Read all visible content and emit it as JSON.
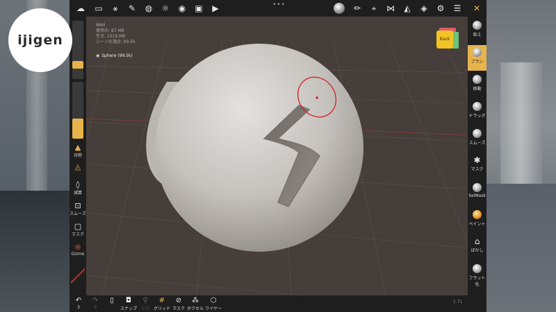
{
  "watermark": {
    "text": "ijigen"
  },
  "topbar": {
    "handle": "•••",
    "left_icons": [
      "cloud-icon",
      "folder-icon",
      "scene-icon",
      "tools-icon",
      "globe-icon",
      "sun-icon",
      "material-icon",
      "image-icon",
      "video-icon"
    ],
    "right_icons": [
      "matcap-icon",
      "paint-icon",
      "picker-icon",
      "symmetry-icon",
      "shading-icon",
      "layers-icon",
      "settings-icon",
      "sliders-icon",
      "wrench-icon"
    ]
  },
  "info": {
    "lines": [
      "RAM",
      "使用中: 87 MB",
      "空き: 1519 MB",
      "シーンの頂点: 99.5k"
    ],
    "mesh_label": "Sphere (99.5k)"
  },
  "left_panel": {
    "radius_fill": 0.25,
    "intensity_fill": 0.35,
    "items": [
      {
        "label": "対称"
      },
      {
        "label": "減算"
      },
      {
        "label": "スムーズ"
      },
      {
        "label": "マスク"
      },
      {
        "label": "Gizmo"
      }
    ]
  },
  "right_panel": {
    "items": [
      {
        "label": "粘土",
        "active": false
      },
      {
        "label": "ブラシ",
        "active": true
      },
      {
        "label": "移動",
        "active": false
      },
      {
        "label": "ドラッグ",
        "active": false
      },
      {
        "label": "スムーズ",
        "active": false
      },
      {
        "label": "マスク",
        "active": false
      },
      {
        "label": "SelMask",
        "active": false
      },
      {
        "label": "ペイント",
        "active": false
      },
      {
        "label": "ぼかし",
        "active": false
      },
      {
        "label": "フラット化",
        "active": false
      }
    ]
  },
  "bottom_bar": {
    "undo": {
      "label": "3"
    },
    "redo": {
      "label": "0"
    },
    "items": [
      {
        "label": "",
        "icon": "phone-icon"
      },
      {
        "label": "スナップ"
      },
      {
        "label": "ソロ"
      },
      {
        "label": "グリッド"
      },
      {
        "label": "マスク"
      },
      {
        "label": "ボクセル"
      },
      {
        "label": "ワイヤー"
      }
    ]
  },
  "cube": {
    "face_label": "Back"
  },
  "version": "1.71",
  "colors": {
    "accent": "#e7b34d",
    "panel": "#1e1e1e",
    "viewport": "#453e3a",
    "selection_ring": "#d4202a"
  }
}
